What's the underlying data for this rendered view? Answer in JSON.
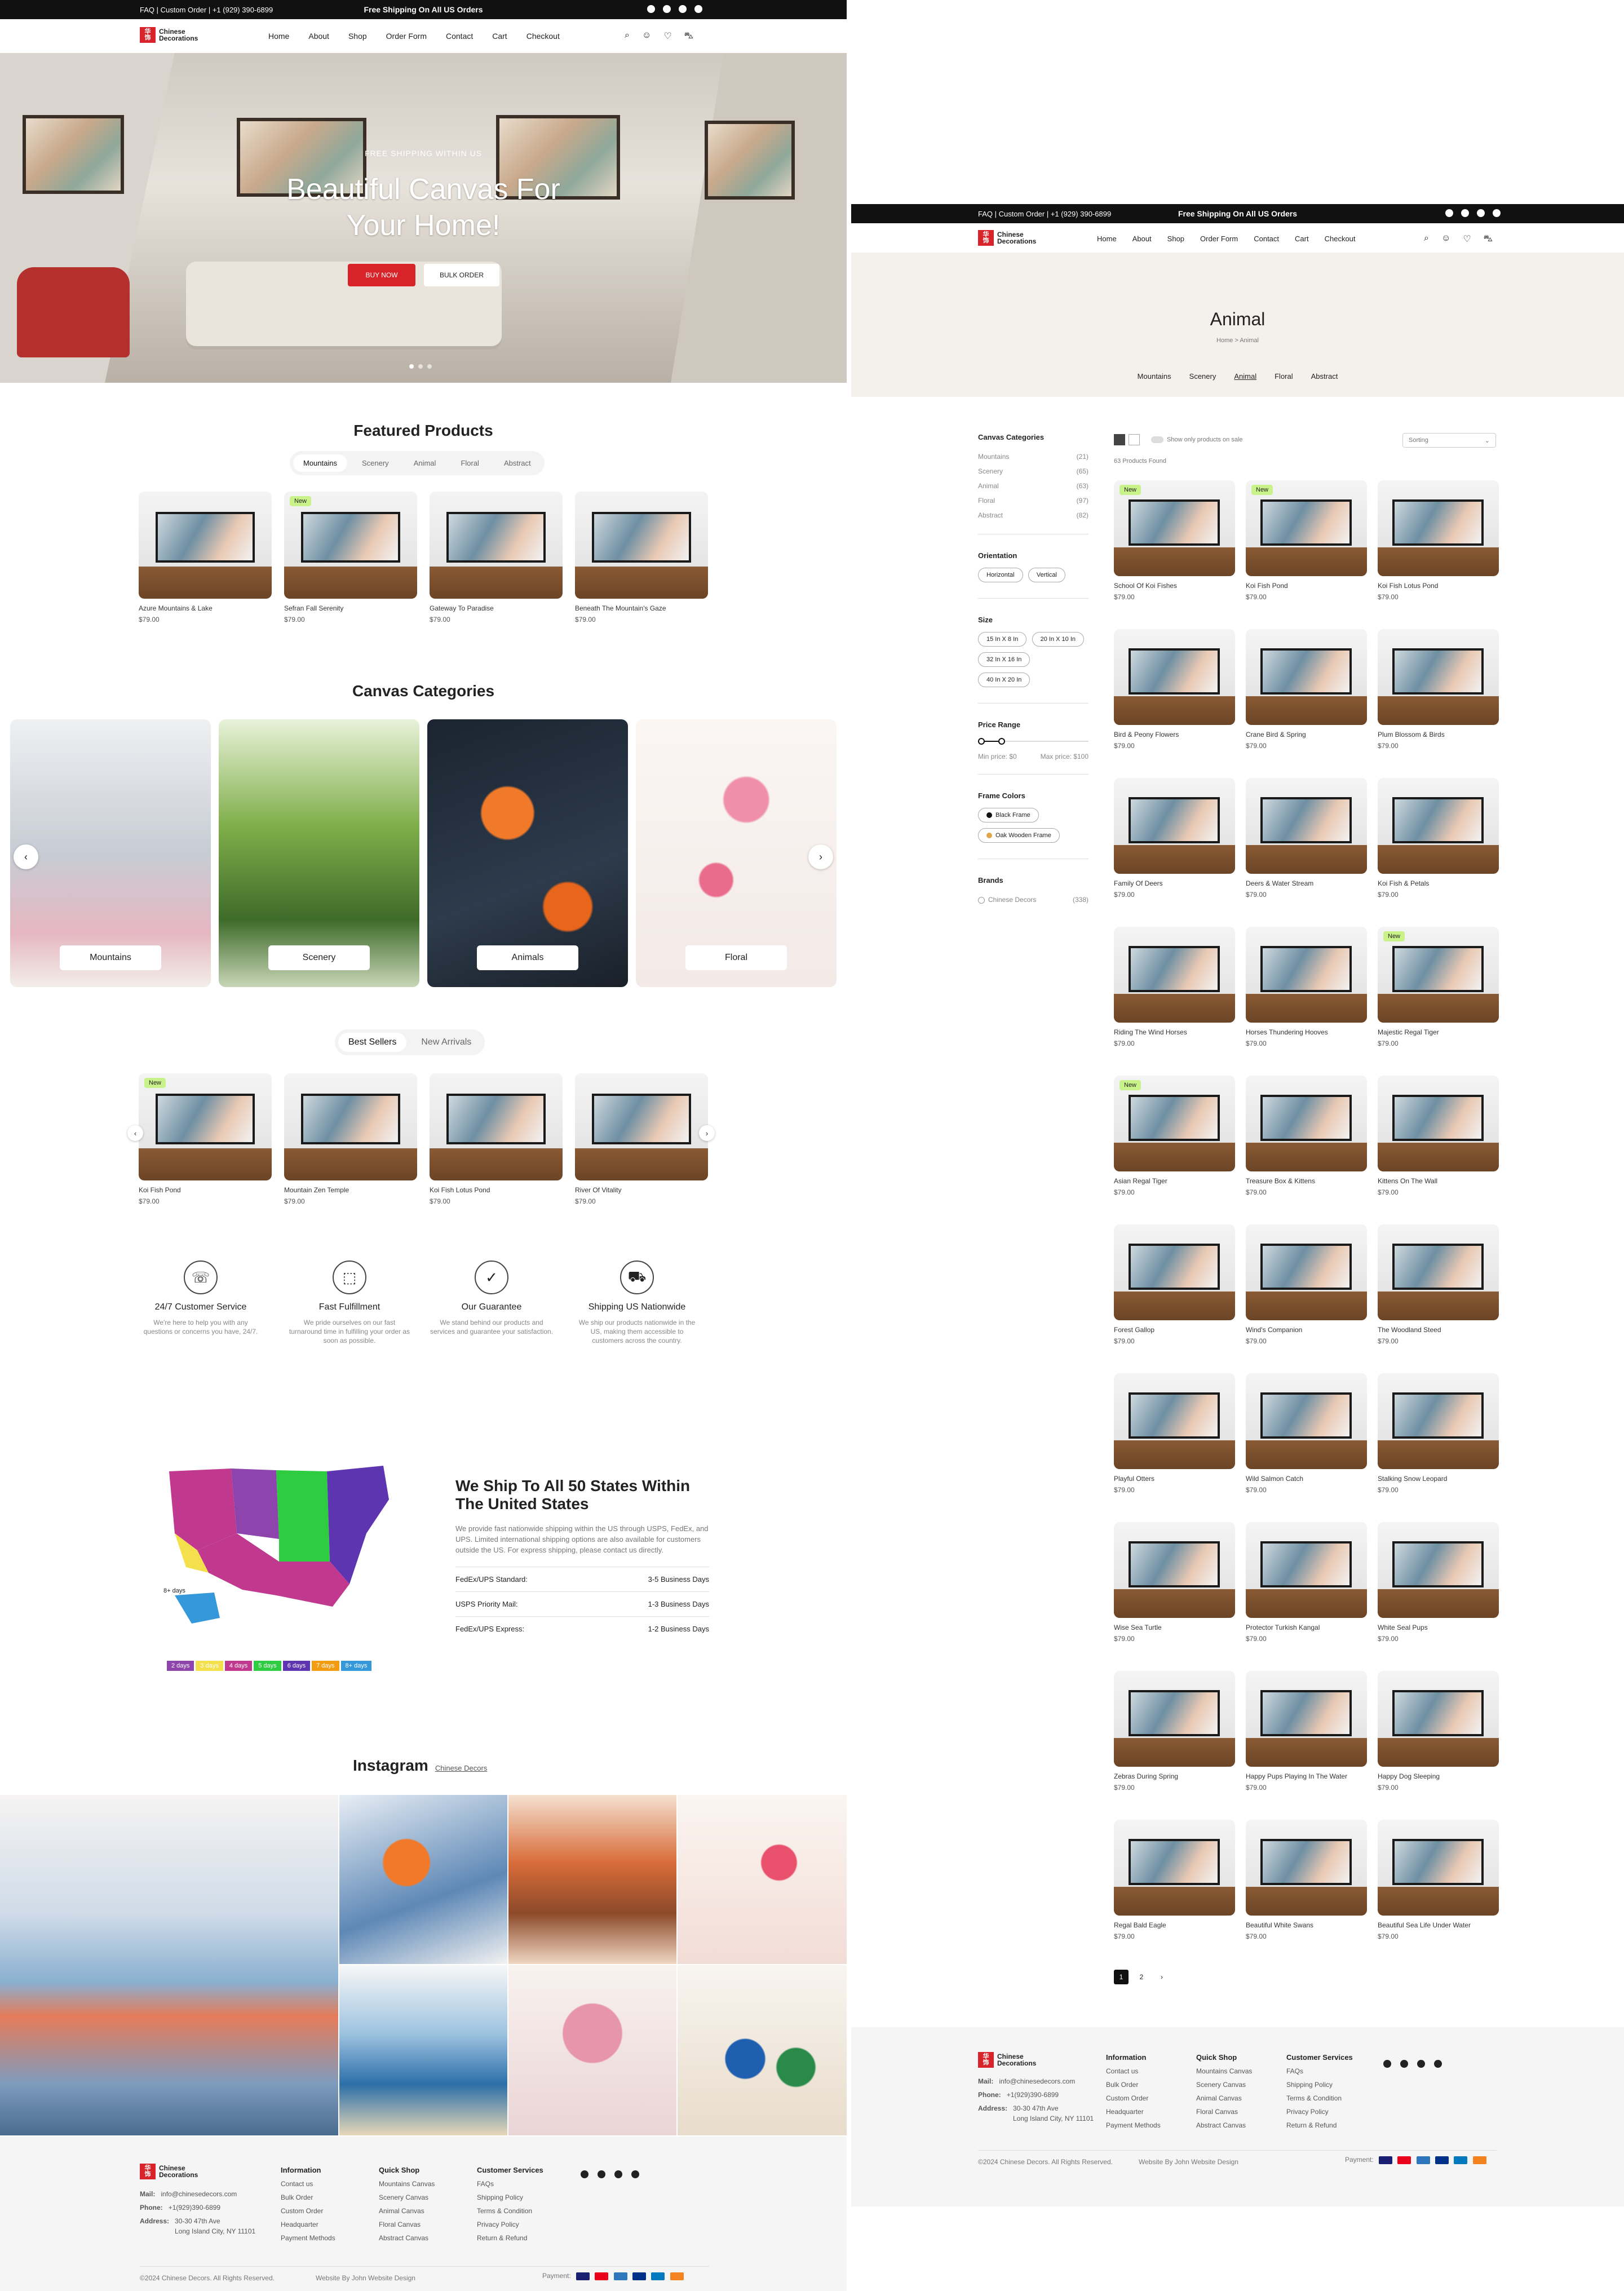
{
  "top_bar": {
    "links": "FAQ | Custom Order | +1 (929) 390-6899",
    "promo": "Free Shipping On All US Orders"
  },
  "logo": {
    "mark": "华\n饰",
    "name": "Chinese Decorations"
  },
  "nav": [
    "Home",
    "About",
    "Shop",
    "Order Form",
    "Contact",
    "Cart",
    "Checkout"
  ],
  "cart_count": "0",
  "hero": {
    "eyebrow": "FREE SHIPPING WITHIN US",
    "title": "Beautiful Canvas For Your Home!",
    "buy_now": "BUY NOW",
    "bulk_order": "BULK ORDER"
  },
  "featured": {
    "title": "Featured Products",
    "tabs": [
      "Mountains",
      "Scenery",
      "Animal",
      "Floral",
      "Abstract"
    ],
    "products": [
      {
        "name": "Azure Mountains & Lake",
        "price": "$79.00",
        "badge": ""
      },
      {
        "name": "Sefran Fall Serenity",
        "price": "$79.00",
        "badge": "New"
      },
      {
        "name": "Gateway To Paradise",
        "price": "$79.00",
        "badge": ""
      },
      {
        "name": "Beneath The Mountain's Gaze",
        "price": "$79.00",
        "badge": ""
      }
    ]
  },
  "categories": {
    "title": "Canvas Categories",
    "items": [
      "Mountains",
      "Scenery",
      "Animals",
      "Floral"
    ]
  },
  "bestsellers": {
    "tabs": [
      "Best Sellers",
      "New Arrivals"
    ],
    "products": [
      {
        "name": "Koi Fish Pond",
        "price": "$79.00",
        "badge": "New"
      },
      {
        "name": "Mountain Zen Temple",
        "price": "$79.00",
        "badge": ""
      },
      {
        "name": "Koi Fish Lotus Pond",
        "price": "$79.00",
        "badge": ""
      },
      {
        "name": "River Of Vitality",
        "price": "$79.00",
        "badge": ""
      }
    ]
  },
  "features": [
    {
      "title": "24/7 Customer Service",
      "desc": "We're here to help you with any questions or concerns you have, 24/7.",
      "icon": "phone-icon",
      "glyph": "☏"
    },
    {
      "title": "Fast Fulfillment",
      "desc": "We pride ourselves on our fast turnaround time in fulfilling your order as soon as possible.",
      "icon": "box-icon",
      "glyph": "⬚"
    },
    {
      "title": "Our Guarantee",
      "desc": "We stand behind our products and services and guarantee your satisfaction.",
      "icon": "badge-check-icon",
      "glyph": "✓"
    },
    {
      "title": "Shipping US Nationwide",
      "desc": "We ship our products nationwide in the US, making them accessible to customers across the country.",
      "icon": "truck-icon",
      "glyph": "⛟"
    }
  ],
  "shipping": {
    "title": "We Ship To All 50 States Within The United States",
    "desc": "We provide fast nationwide shipping within the US through USPS, FedEx, and UPS. Limited international shipping options are also available for customers outside the US. For express shipping, please contact us directly.",
    "rows": [
      {
        "label": "FedEx/UPS Standard:",
        "value": "3-5 Business Days"
      },
      {
        "label": "USPS Priority Mail:",
        "value": "1-3 Business Days"
      },
      {
        "label": "FedEx/UPS Express:",
        "value": "1-2 Business Days"
      }
    ],
    "legend": [
      "2 days",
      "3 days",
      "4 days",
      "5 days",
      "6 days",
      "7 days",
      "8+ days"
    ],
    "legend_colors": [
      "#8e44ad",
      "#f4e04d",
      "#c0398f",
      "#2ecc40",
      "#5e35b1",
      "#f39c12",
      "#3498db"
    ],
    "alaska_label": "8+ days"
  },
  "instagram": {
    "title": "Instagram",
    "link": "Chinese Decors"
  },
  "footer": {
    "mail_label": "Mail:",
    "mail": "info@chinesedecors.com",
    "phone_label": "Phone:",
    "phone": "+1(929)390-6899",
    "address_label": "Address:",
    "address1": "30-30 47th Ave",
    "address2": "Long Island City, NY 11101",
    "cols": [
      {
        "title": "Information",
        "items": [
          "Contact us",
          "Bulk Order",
          "Custom Order",
          "Headquarter",
          "Payment Methods"
        ]
      },
      {
        "title": "Quick Shop",
        "items": [
          "Mountains Canvas",
          "Scenery Canvas",
          "Animal Canvas",
          "Floral Canvas",
          "Abstract Canvas"
        ]
      },
      {
        "title": "Customer Services",
        "items": [
          "FAQs",
          "Shipping Policy",
          "Terms & Condition",
          "Privacy Policy",
          "Return & Refund"
        ]
      }
    ],
    "copyright": "©2024 Chinese Decors. All Rights Reserved.",
    "credit": "Website By John Website Design",
    "payment_label": "Payment:"
  },
  "animal_page": {
    "title": "Animal",
    "breadcrumb": "Home > Animal",
    "subnav": [
      "Mountains",
      "Scenery",
      "Animal",
      "Floral",
      "Abstract"
    ],
    "sidebar": {
      "cat_title": "Canvas Categories",
      "cats": [
        {
          "n": "Mountains",
          "c": "(21)"
        },
        {
          "n": "Scenery",
          "c": "(65)"
        },
        {
          "n": "Animal",
          "c": "(63)"
        },
        {
          "n": "Floral",
          "c": "(97)"
        },
        {
          "n": "Abstract",
          "c": "(82)"
        }
      ],
      "orient_title": "Orientation",
      "orient": [
        "Horizontal",
        "Vertical"
      ],
      "size_title": "Size",
      "sizes": [
        "15 In X 8 In",
        "20 In X 10 In",
        "32 In X 16 In",
        "40 In X 20 In"
      ],
      "price_title": "Price Range",
      "price_min": "Min price: $0",
      "price_max": "Max price: $100",
      "frame_title": "Frame Colors",
      "frames": [
        "Black Frame",
        "Oak Wooden Frame"
      ],
      "brand_title": "Brands",
      "brand": "Chinese Decors",
      "brand_count": "(338)"
    },
    "sale_toggle": "Show only products on sale",
    "count": "63 Products Found",
    "sort": "Sorting",
    "products": [
      {
        "name": "School Of Koi Fishes",
        "price": "$79.00",
        "badge": "New"
      },
      {
        "name": "Koi Fish Pond",
        "price": "$79.00",
        "badge": "New"
      },
      {
        "name": "Koi Fish Lotus Pond",
        "price": "$79.00",
        "badge": ""
      },
      {
        "name": "Bird & Peony Flowers",
        "price": "$79.00",
        "badge": ""
      },
      {
        "name": "Crane Bird & Spring",
        "price": "$79.00",
        "badge": ""
      },
      {
        "name": "Plum Blossom & Birds",
        "price": "$79.00",
        "badge": ""
      },
      {
        "name": "Family Of Deers",
        "price": "$79.00",
        "badge": ""
      },
      {
        "name": "Deers & Water Stream",
        "price": "$79.00",
        "badge": ""
      },
      {
        "name": "Koi Fish & Petals",
        "price": "$79.00",
        "badge": ""
      },
      {
        "name": "Riding The Wind Horses",
        "price": "$79.00",
        "badge": ""
      },
      {
        "name": "Horses Thundering Hooves",
        "price": "$79.00",
        "badge": ""
      },
      {
        "name": "Majestic Regal Tiger",
        "price": "$79.00",
        "badge": "New"
      },
      {
        "name": "Asian Regal Tiger",
        "price": "$79.00",
        "badge": "New"
      },
      {
        "name": "Treasure Box & Kittens",
        "price": "$79.00",
        "badge": ""
      },
      {
        "name": "Kittens On The Wall",
        "price": "$79.00",
        "badge": ""
      },
      {
        "name": "Forest Gallop",
        "price": "$79.00",
        "badge": ""
      },
      {
        "name": "Wind's Companion",
        "price": "$79.00",
        "badge": ""
      },
      {
        "name": "The Woodland Steed",
        "price": "$79.00",
        "badge": ""
      },
      {
        "name": "Playful Otters",
        "price": "$79.00",
        "badge": ""
      },
      {
        "name": "Wild Salmon Catch",
        "price": "$79.00",
        "badge": ""
      },
      {
        "name": "Stalking Snow Leopard",
        "price": "$79.00",
        "badge": ""
      },
      {
        "name": "Wise Sea Turtle",
        "price": "$79.00",
        "badge": ""
      },
      {
        "name": "Protector Turkish Kangal",
        "price": "$79.00",
        "badge": ""
      },
      {
        "name": "White Seal Pups",
        "price": "$79.00",
        "badge": ""
      },
      {
        "name": "Zebras During Spring",
        "price": "$79.00",
        "badge": ""
      },
      {
        "name": "Happy Pups Playing In The Water",
        "price": "$79.00",
        "badge": ""
      },
      {
        "name": "Happy Dog Sleeping",
        "price": "$79.00",
        "badge": ""
      },
      {
        "name": "Regal Bald Eagle",
        "price": "$79.00",
        "badge": ""
      },
      {
        "name": "Beautiful White Swans",
        "price": "$79.00",
        "badge": ""
      },
      {
        "name": "Beautiful Sea Life Under Water",
        "price": "$79.00",
        "badge": ""
      }
    ],
    "pager": [
      "1",
      "2",
      "›"
    ]
  }
}
